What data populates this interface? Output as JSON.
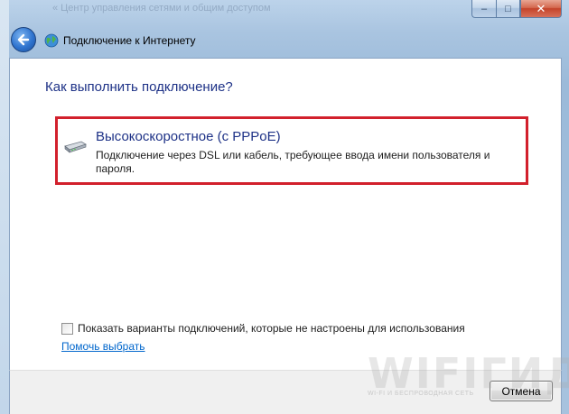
{
  "window": {
    "title": "Подключение к Интернету",
    "background_breadcrumb": "« Центр управления сетями и общим доступом"
  },
  "caption_buttons": {
    "minimize": "–",
    "maximize": "□",
    "close": "✕"
  },
  "content": {
    "heading": "Как выполнить подключение?",
    "option": {
      "title": "Высокоскоростное (с PPPoE)",
      "description": "Подключение через DSL или кабель, требующее ввода имени пользователя и пароля.",
      "icon": "modem-icon"
    },
    "checkbox": {
      "label": "Показать варианты подключений, которые не настроены для использования",
      "checked": false
    },
    "help_link": "Помочь выбрать"
  },
  "footer": {
    "cancel_label": "Отмена"
  },
  "watermark": {
    "big": "WIFIГИД",
    "small": "WI-FI И БЕСПРОВОДНАЯ СЕТЬ"
  },
  "colors": {
    "heading": "#1e3287",
    "highlight_border": "#d2202c",
    "link": "#0066cc"
  }
}
